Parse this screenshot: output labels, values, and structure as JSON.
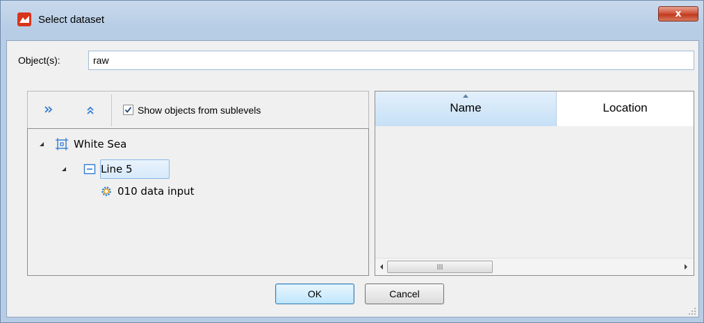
{
  "window": {
    "title": "Select dataset",
    "close_label": "x"
  },
  "filter": {
    "label": "Object(s):",
    "value": "raw"
  },
  "toolbar": {
    "expand_all_icon": "double-chevron-right-icon",
    "collapse_all_icon": "double-chevron-up-icon",
    "show_sublevels": {
      "label": "Show objects from sublevels",
      "checked": true
    }
  },
  "tree": {
    "items": [
      {
        "label": "White Sea",
        "icon": "survey-icon",
        "expanded": true
      },
      {
        "label": "Line 5",
        "icon": "line-icon",
        "expanded": true,
        "selected": true
      },
      {
        "label": "010 data input",
        "icon": "gear-icon"
      }
    ]
  },
  "grid": {
    "columns": [
      {
        "label": "Name",
        "sorted": "ascending"
      },
      {
        "label": "Location"
      }
    ],
    "rows": [],
    "scroll_thumb_glyph": "III"
  },
  "buttons": {
    "ok": "OK",
    "cancel": "Cancel"
  },
  "colors": {
    "accent": "#2e7ad2",
    "title_icon": "#d8341c",
    "close_button": "#c94a30"
  }
}
